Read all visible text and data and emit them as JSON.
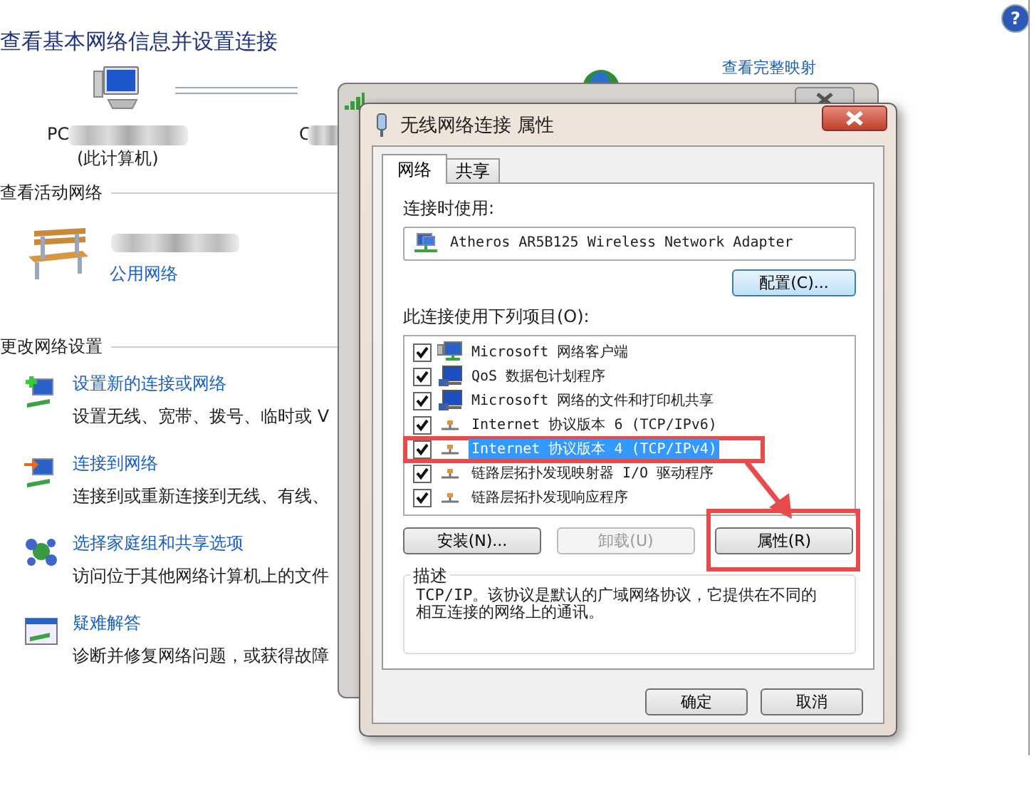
{
  "control_panel": {
    "title": "查看基本网络信息并设置连接",
    "computer": {
      "name": "PC",
      "caption": "(此计算机)"
    },
    "network_node": {
      "name": "C"
    },
    "map_link": "查看完整映射",
    "active_networks": {
      "heading": "查看活动网络",
      "network_type": "公用网络"
    },
    "change_settings": {
      "heading": "更改网络设置",
      "tasks": [
        {
          "title": "设置新的连接或网络",
          "description": "设置无线、宽带、拨号、临时或 V"
        },
        {
          "title": "连接到网络",
          "description": "连接到或重新连接到无线、有线、"
        },
        {
          "title": "选择家庭组和共享选项",
          "description": "访问位于其他网络计算机上的文件"
        },
        {
          "title": "疑难解答",
          "description": "诊断并修复网络问题，或获得故障"
        }
      ]
    }
  },
  "help_button": "?",
  "properties_dialog": {
    "title": "无线网络连接 属性",
    "tabs": [
      {
        "label": "网络",
        "selected": true
      },
      {
        "label": "共享",
        "selected": false
      }
    ],
    "connect_using_label": "连接时使用:",
    "adapter": "Atheros AR5B125 Wireless Network Adapter",
    "configure_button": "配置(C)...",
    "items_label": "此连接使用下列项目(O):",
    "items": [
      {
        "kind": "client",
        "label": "Microsoft 网络客户端",
        "checked": true,
        "selected": false
      },
      {
        "kind": "service",
        "label": "QoS 数据包计划程序",
        "checked": true,
        "selected": false
      },
      {
        "kind": "service",
        "label": "Microsoft 网络的文件和打印机共享",
        "checked": true,
        "selected": false
      },
      {
        "kind": "protocol",
        "label": "Internet 协议版本 6 (TCP/IPv6)",
        "checked": true,
        "selected": false
      },
      {
        "kind": "protocol",
        "label": "Internet 协议版本 4 (TCP/IPv4)",
        "checked": true,
        "selected": true
      },
      {
        "kind": "protocol",
        "label": "链路层拓扑发现映射器 I/O 驱动程序",
        "checked": true,
        "selected": false
      },
      {
        "kind": "protocol",
        "label": "链路层拓扑发现响应程序",
        "checked": true,
        "selected": false
      }
    ],
    "buttons": [
      {
        "label": "安装(N)...",
        "disabled": false
      },
      {
        "label": "卸载(U)",
        "disabled": true
      },
      {
        "label": "属性(R)",
        "disabled": false
      }
    ],
    "description_label": "描述",
    "description": "TCP/IP。该协议是默认的广域网络协议，它提供在不同的相互连接的网络上的通讯。",
    "ok_button": "确定",
    "cancel_button": "取消"
  }
}
